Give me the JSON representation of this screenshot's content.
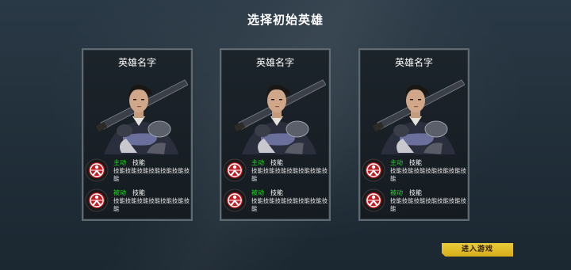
{
  "title": "选择初始英雄",
  "heroes": [
    {
      "name": "英雄名字",
      "active": {
        "type": "主动",
        "label": "技能",
        "desc": "技能技能技能技能技能技能技能"
      },
      "passive": {
        "type": "被动",
        "label": "技能",
        "desc": "技能技能技能技能技能技能技能"
      }
    },
    {
      "name": "英雄名字",
      "active": {
        "type": "主动",
        "label": "技能",
        "desc": "技能技能技能技能技能技能技能"
      },
      "passive": {
        "type": "被动",
        "label": "技能",
        "desc": "技能技能技能技能技能技能技能"
      }
    },
    {
      "name": "英雄名字",
      "active": {
        "type": "主动",
        "label": "技能",
        "desc": "技能技能技能技能技能技能技能"
      },
      "passive": {
        "type": "被动",
        "label": "技能",
        "desc": "技能技能技能技能技能技能技能"
      }
    }
  ],
  "enter_button": "进入游戏",
  "colors": {
    "skill_type": "#22d822",
    "button": "#e2bf2c",
    "icon_red": "#c0181f"
  },
  "icons": {
    "portrait": "hero-portrait-icon",
    "skill": "skill-emblem-icon"
  }
}
